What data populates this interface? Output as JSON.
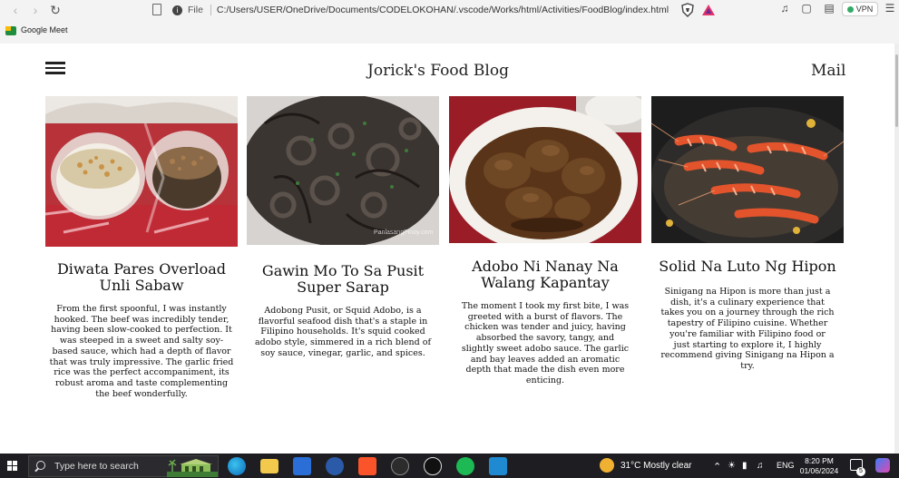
{
  "browser": {
    "address_prefix": "File",
    "address_url": "C:/Users/USER/OneDrive/Documents/CODELOKOHAN/.vscode/Works/html/Activities/FoodBlog/index.html",
    "vpn_label": "VPN",
    "bookmark_label": "Google Meet"
  },
  "header": {
    "site_title": "Jorick's Food Blog",
    "mail_label": "Mail"
  },
  "cards": [
    {
      "title": "Diwata Pares Overload Unli Sabaw",
      "body": "From the first spoonful, I was instantly hooked. The beef was incredibly tender, having been slow-cooked to perfection. It was steeped in a sweet and salty soy-based sauce, which had a depth of flavor that was truly impressive. The garlic fried rice was the perfect accompaniment, its robust aroma and taste complementing the beef wonderfully."
    },
    {
      "title": "Gawin Mo To Sa Pusit Super Sarap",
      "body": "Adobong Pusit, or Squid Adobo, is a flavorful seafood dish that's a staple in Filipino households. It's squid cooked adobo style, simmered in a rich blend of soy sauce, vinegar, garlic, and spices.",
      "watermark": "PanlasangPinoy.com"
    },
    {
      "title": "Adobo Ni Nanay Na Walang Kapantay",
      "body": "The moment I took my first bite, I was greeted with a burst of flavors. The chicken was tender and juicy, having absorbed the savory, tangy, and slightly sweet adobo sauce. The garlic and bay leaves added an aromatic depth that made the dish even more enticing."
    },
    {
      "title": "Solid Na Luto Ng Hipon",
      "body": "Sinigang na Hipon is more than just a dish, it's a culinary experience that takes you on a journey through the rich tapestry of Filipino cuisine. Whether you're familiar with Filipino food or just starting to explore it, I highly recommend giving Sinigang na Hipon a try."
    }
  ],
  "taskbar": {
    "search_placeholder": "Type here to search",
    "weather": "31°C  Mostly clear",
    "language": "ENG",
    "time": "8:20 PM",
    "date": "01/06/2024",
    "notification_count": "5"
  }
}
